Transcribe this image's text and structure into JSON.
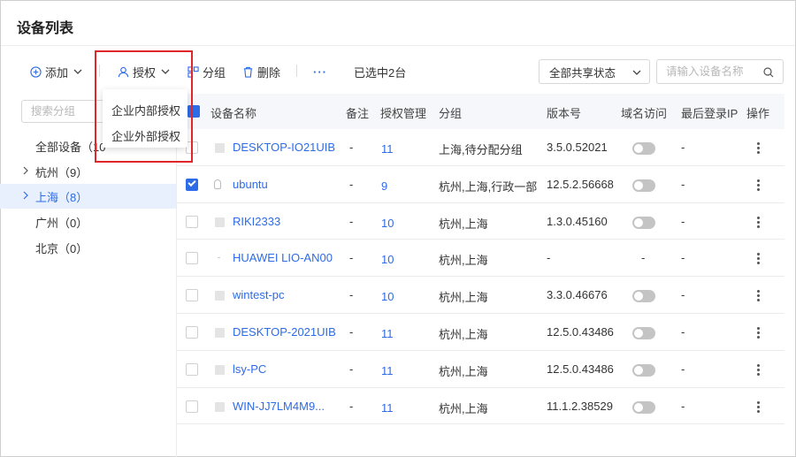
{
  "page": {
    "title": "设备列表"
  },
  "toolbar": {
    "add_label": "添加",
    "auth_label": "授权",
    "group_label": "分组",
    "delete_label": "删除",
    "more_label": "···",
    "selected_text": "已选中2台",
    "share_filter": "全部共享状态",
    "search_placeholder": "请输入设备名称"
  },
  "auth_menu": {
    "items": [
      "企业内部授权",
      "企业外部授权"
    ]
  },
  "sidebar": {
    "search_placeholder": "搜索分组",
    "items": [
      {
        "label": "全部设备（10"
      },
      {
        "label": "杭州（9）"
      },
      {
        "label": "上海（8）"
      },
      {
        "label": "广州（0）"
      },
      {
        "label": "北京（0）"
      }
    ]
  },
  "table": {
    "columns": [
      "设备名称",
      "备注",
      "授权管理",
      "分组",
      "版本号",
      "域名访问",
      "最后登录IP",
      "操作"
    ],
    "rows": [
      {
        "name": "DESKTOP-IO21UIB",
        "note": "-",
        "auth": "11",
        "group": "上海,待分配分组",
        "version": "3.5.0.52021",
        "domain": "",
        "ip": "-",
        "checked": false
      },
      {
        "name": "ubuntu",
        "note": "-",
        "auth": "9",
        "group": "杭州,上海,行政一部",
        "version": "12.5.2.56668",
        "domain": "",
        "ip": "-",
        "checked": true
      },
      {
        "name": "RIKI2333",
        "note": "-",
        "auth": "10",
        "group": "杭州,上海",
        "version": "1.3.0.45160",
        "domain": "",
        "ip": "-",
        "checked": false
      },
      {
        "name": "HUAWEI LIO-AN00",
        "note": "-",
        "auth": "10",
        "group": "杭州,上海",
        "version": "-",
        "domain": "-",
        "ip": "-",
        "checked": false
      },
      {
        "name": "wintest-pc",
        "note": "-",
        "auth": "10",
        "group": "杭州,上海",
        "version": "3.3.0.46676",
        "domain": "",
        "ip": "-",
        "checked": false
      },
      {
        "name": "DESKTOP-2021UIB",
        "note": "-",
        "auth": "11",
        "group": "杭州,上海",
        "version": "12.5.0.43486",
        "domain": "",
        "ip": "-",
        "checked": false
      },
      {
        "name": "lsy-PC",
        "note": "-",
        "auth": "11",
        "group": "杭州,上海",
        "version": "12.5.0.43486",
        "domain": "",
        "ip": "-",
        "checked": false
      },
      {
        "name": "WIN-JJ7LM4M9...",
        "note": "-",
        "auth": "11",
        "group": "杭州,上海",
        "version": "11.1.2.38529",
        "domain": "",
        "ip": "-",
        "checked": false
      }
    ]
  },
  "colors": {
    "accent": "#2e6be6",
    "highlight_box": "#e0262b",
    "active_bg": "#e8f0fe"
  }
}
